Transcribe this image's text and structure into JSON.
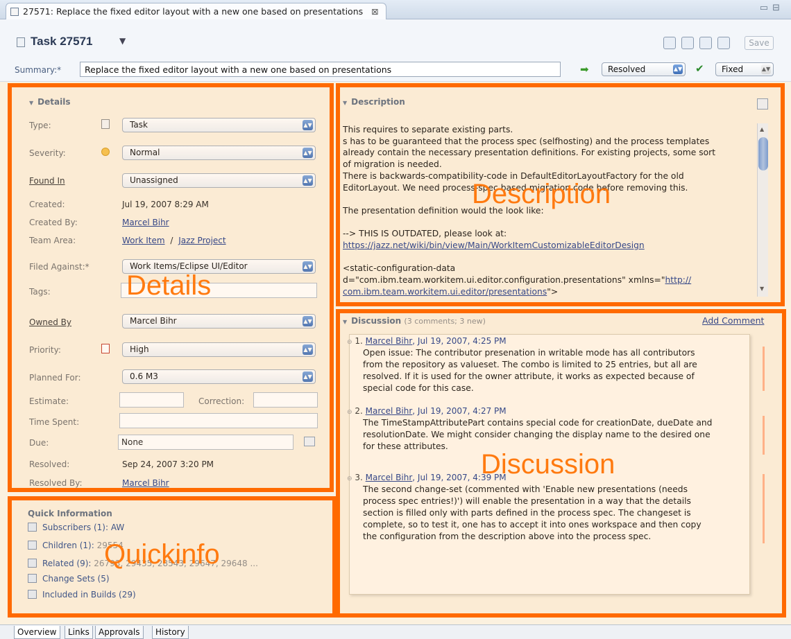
{
  "editor_tab": {
    "title": "27571: Replace the fixed editor layout with a new one based on presentations",
    "close_glyph": "⊠"
  },
  "window_controls": {
    "minimize": "▭",
    "maximize": "⊟"
  },
  "header": {
    "title": "Task 27571",
    "save_label": "Save",
    "summary_label": "Summary:*",
    "summary_value": "Replace the fixed editor layout with a new one based on presentations",
    "state": "Resolved",
    "resolution": "Fixed"
  },
  "details": {
    "title": "Details",
    "type_label": "Type:",
    "type_value": "Task",
    "severity_label": "Severity:",
    "severity_value": "Normal",
    "found_in_label": "Found In",
    "found_in_value": "Unassigned",
    "created_label": "Created:",
    "created_value": "Jul 19, 2007 8:29 AM",
    "created_by_label": "Created By:",
    "created_by_value": "Marcel Bihr",
    "team_area_label": "Team Area:",
    "team_area_value1": "Work Item",
    "team_area_sep": "/",
    "team_area_value2": "Jazz Project",
    "filed_against_label": "Filed Against:*",
    "filed_against_value": "Work Items/Eclipse UI/Editor",
    "tags_label": "Tags:",
    "owned_by_label": "Owned By",
    "owned_by_value": "Marcel Bihr",
    "priority_label": "Priority:",
    "priority_value": "High",
    "planned_for_label": "Planned For:",
    "planned_for_value": "0.6 M3",
    "estimate_label": "Estimate:",
    "correction_label": "Correction:",
    "time_spent_label": "Time Spent:",
    "due_label": "Due:",
    "due_value": "None",
    "resolved_label": "Resolved:",
    "resolved_value": "Sep 24, 2007 3:20 PM",
    "resolved_by_label": "Resolved By:",
    "resolved_by_value": "Marcel Bihr"
  },
  "description": {
    "title": "Description",
    "lines": [
      "This requires to separate existing parts.",
      "s has to be guaranteed that the process spec (selfhosting) and the process templates",
      "already contain the necessary presentation definitions. For existing projects, some sort",
      "of migration is needed.",
      "There is backwards-compatibility-code in DefaultEditorLayoutFactory for the old",
      "EditorLayout. We need process-spec based migration code before removing this.",
      "",
      "The presentation definition would the look like:",
      "",
      "--> THIS IS OUTDATED, please look at:"
    ],
    "link1": "https://jazz.net/wiki/bin/view/Main/WorkItemCustomizableEditorDesign",
    "line_tag": "<static-configuration-data",
    "line_id_prefix": "d=\"com.ibm.team.workitem.ui.editor.configuration.presentations\" xmlns=\"",
    "line_id_link": "http://",
    "line_last_link": "com.ibm.team.workitem.ui.editor/presentations",
    "line_last_suffix": "\">"
  },
  "discussion": {
    "title": "Discussion",
    "count": "(3 comments; 3 new)",
    "add_comment": "Add Comment",
    "comments": [
      {
        "num": "1.",
        "author": "Marcel Bihr",
        "date": ", Jul 19, 2007, 4:25 PM",
        "lines": [
          "Open issue: The contributor presenation in writable mode has all contributors",
          "from the repository as valueset. The combo is limited to 25 entries, but all are",
          "resolved. If it is used for the owner attribute, it works as expected because of",
          "special code for this case."
        ]
      },
      {
        "num": "2.",
        "author": "Marcel Bihr",
        "date": ", Jul 19, 2007, 4:27 PM",
        "lines": [
          "The TimeStampAttributePart contains special code for creationDate, dueDate and",
          "resolutionDate. We might consider changing the display name to the desired one",
          "for these attributes."
        ]
      },
      {
        "num": "3.",
        "author": "Marcel Bihr",
        "date": ", Jul 19, 2007, 4:39 PM",
        "lines": [
          "The second change-set (commented with 'Enable new presentations (needs",
          "process spec entries!)') will enable the presentation in a way that the details",
          "section is filled only with parts defined in the process spec. The changeset is",
          "complete, so to test it, one has to accept it into ones workspace and then copy",
          "the configuration from the description above into the process spec."
        ]
      }
    ]
  },
  "quickinfo": {
    "title": "Quick Information",
    "subscribers": "Subscribers (1):",
    "subscribers_val": "AW",
    "children": "Children (1):",
    "children_val": "29554",
    "related": "Related (9):",
    "related_val": "26793, 29435, 28543, 29647, 29648 ...",
    "changesets": "Change Sets (5)",
    "builds": "Included in Builds (29)"
  },
  "annotations": {
    "details": "Details",
    "description": "Description",
    "discussion": "Discussion",
    "quickinfo": "Quickinfo"
  },
  "bottom_tabs": [
    "Overview",
    "Links",
    "Approvals",
    "History"
  ]
}
